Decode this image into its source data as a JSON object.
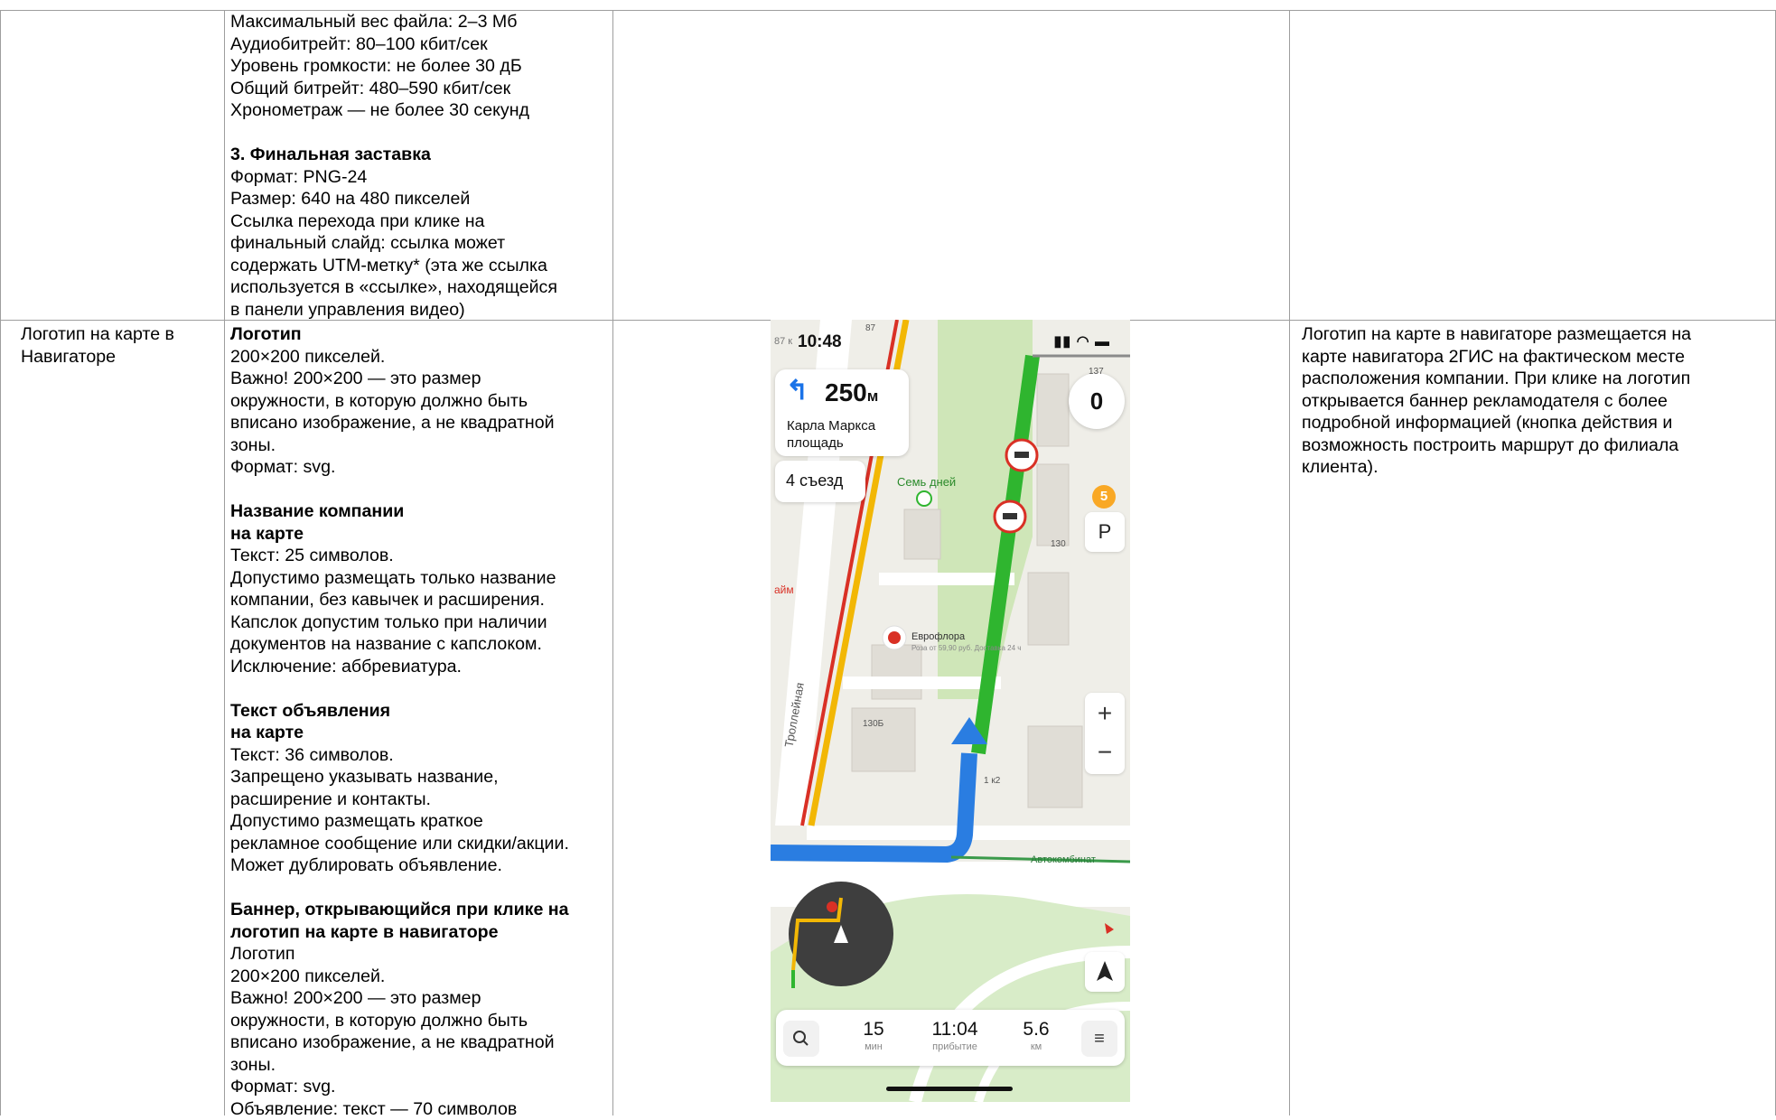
{
  "top_row": {
    "requirements": [
      "Максимальный вес файла: 2–3 Мб",
      "Аудиобитрейт: 80–100 кбит/сек",
      "Уровень громкости: не более 30 дБ",
      "Общий битрейт: 480–590 кбит/сек",
      "Хронометраж — не более 30 секунд"
    ],
    "final_title": "3. Финальная заставка",
    "final_lines": [
      "Формат: PNG-24",
      "Размер: 640 на 480 пикселей",
      "Ссылка перехода при клике на",
      "финальный слайд: ссылка может",
      "содержать UTM-метку* (эта же ссылка",
      "используется в «ссылке», находящейся",
      "в панели управления видео)"
    ]
  },
  "row": {
    "name_lines": [
      "Логотип на карте в",
      "Навигаторе"
    ],
    "logo_title": "Логотип",
    "logo_lines": [
      "200×200 пикселей.",
      "Важно! 200×200 — это размер",
      "окружности, в которую должно быть",
      "вписано изображение, а не квадратной",
      "зоны.",
      "Формат: svg."
    ],
    "company_title_1": "Название компании",
    "company_title_2": "на карте",
    "company_lines": [
      "Текст: 25 символов.",
      "Допустимо размещать только название",
      "компании, без кавычек и расширения.",
      "Капслок допустим только при наличии",
      "документов на название с капслоком.",
      "Исключение: аббревиатура."
    ],
    "ad_title_1": "Текст объявления",
    "ad_title_2": "на карте",
    "ad_lines": [
      "Текст: 36 символов.",
      "Запрещено указывать название,",
      "расширение и контакты.",
      "Допустимо размещать краткое",
      "рекламное сообщение или скидки/акции.",
      "Может дублировать объявление."
    ],
    "banner_title_1": "Баннер, открывающийся при клике на",
    "banner_title_2": "логотип на карте в навигаторе",
    "banner_lines": [
      "Логотип",
      "200×200 пикселей.",
      "Важно! 200×200 — это размер",
      "окружности, в которую должно быть",
      "вписано изображение, а не квадратной",
      "зоны.",
      "Формат: svg.",
      "Объявление: текст — 70 символов"
    ],
    "description_lines": [
      "Логотип на карте в навигаторе размещается на",
      "карте навигатора 2ГИС на фактическом месте",
      "расположения компании. При клике на логотип",
      "открывается баннер рекламодателя с более",
      "подробной информацией (кнопка действия и",
      "возможность построить маршрут до филиала",
      "клиента)."
    ]
  },
  "phone": {
    "status_time": "10:48",
    "status_left": "87 к",
    "turn_distance": "250",
    "turn_unit": "м",
    "street_line1": "Карла Маркса",
    "street_line2": "площадь",
    "exit": "4 съезд",
    "speed": "0",
    "badge": "5",
    "parking": "P",
    "zoom_in": "+",
    "zoom_out": "−",
    "labels": {
      "sem_dney": "Семь дней",
      "evroflora": "Еврофлора",
      "evroflora_ad": "Роза от 59,90 руб. Доставка 24 ч",
      "trolleybus": "Троллейная",
      "avtokombinat": "Автокомбинат",
      "aym": "айм",
      "n130": "130",
      "n130b": "130Б",
      "n137": "137",
      "n1k2": "1 к2",
      "n87": "87"
    },
    "stats": [
      {
        "value": "15",
        "unit": "мин"
      },
      {
        "value": "11:04",
        "unit": "прибытие"
      },
      {
        "value": "5.6",
        "unit": "км"
      }
    ],
    "menu": "≡"
  }
}
